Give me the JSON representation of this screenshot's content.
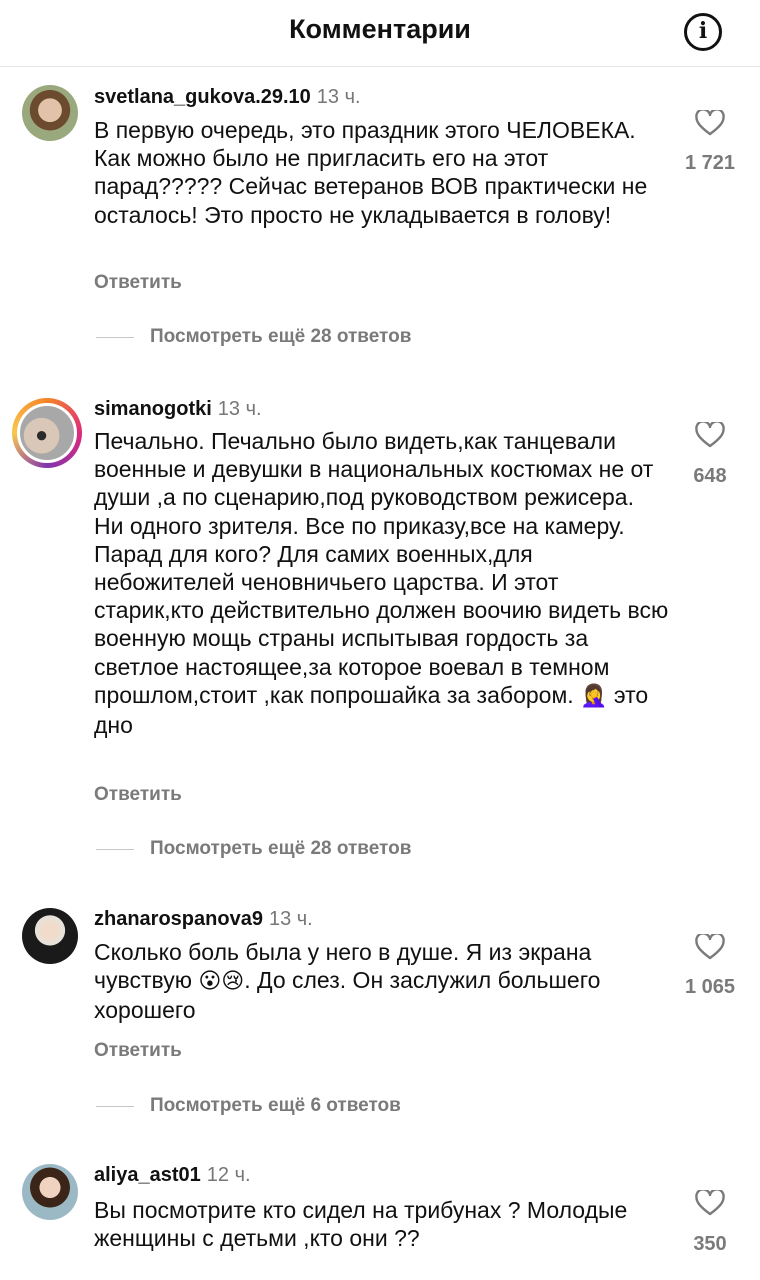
{
  "header": {
    "title": "Комментарии",
    "info_icon": "info-icon"
  },
  "comments": [
    {
      "username": "svetlana_gukova.29.10",
      "time": "13 ч.",
      "text": "В первую очередь, это праздник этого ЧЕЛОВЕКА. Как можно было не пригласить его на этот парад????? Сейчас ветеранов ВОВ практически не осталось! Это просто не укладывается в голову!",
      "likes": "1 721",
      "reply": "Ответить",
      "view_more": "Посмотреть ещё 28 ответов"
    },
    {
      "username": "simanogotki",
      "time": "13 ч.",
      "text": "Печально. Печально было видеть,как танцевали военные и девушки в национальных костюмах не от души ,а по сценарию,под руководством режисера. Ни одного зрителя. Все по приказу,все на камеру. Парад для кого? Для самих военных,для небожителей ченовничьего царства. И этот старик,кто действительно должен воочию видеть всю военную мощь страны испытывая гордость за светлое настоящее,за которое воевал в темном прошлом,стоит ,как попрошайка за забором.",
      "emoji": "🤦‍♀️",
      "text_after": "это дно",
      "likes": "648",
      "reply": "Ответить",
      "view_more": "Посмотреть ещё 28 ответов"
    },
    {
      "username": "zhanarospanova9",
      "time": "13 ч.",
      "text": "Сколько боль была у него в душе.  Я из экрана чувствую",
      "emoji": "😮😢",
      "text_after": ". До слез. Он  заслужил большего хорошего",
      "likes": "1 065",
      "reply": "Ответить",
      "view_more": "Посмотреть ещё 6 ответов"
    },
    {
      "username": "aliya_ast01",
      "time": "12 ч.",
      "text": "Вы посмотрите кто сидел на трибунах ? Молодые женщины с детьми ,кто они ??",
      "likes": "350"
    }
  ],
  "colors": {
    "text": "#111111",
    "secondary": "#7a7a7a",
    "divider": "#e6e6e6"
  }
}
